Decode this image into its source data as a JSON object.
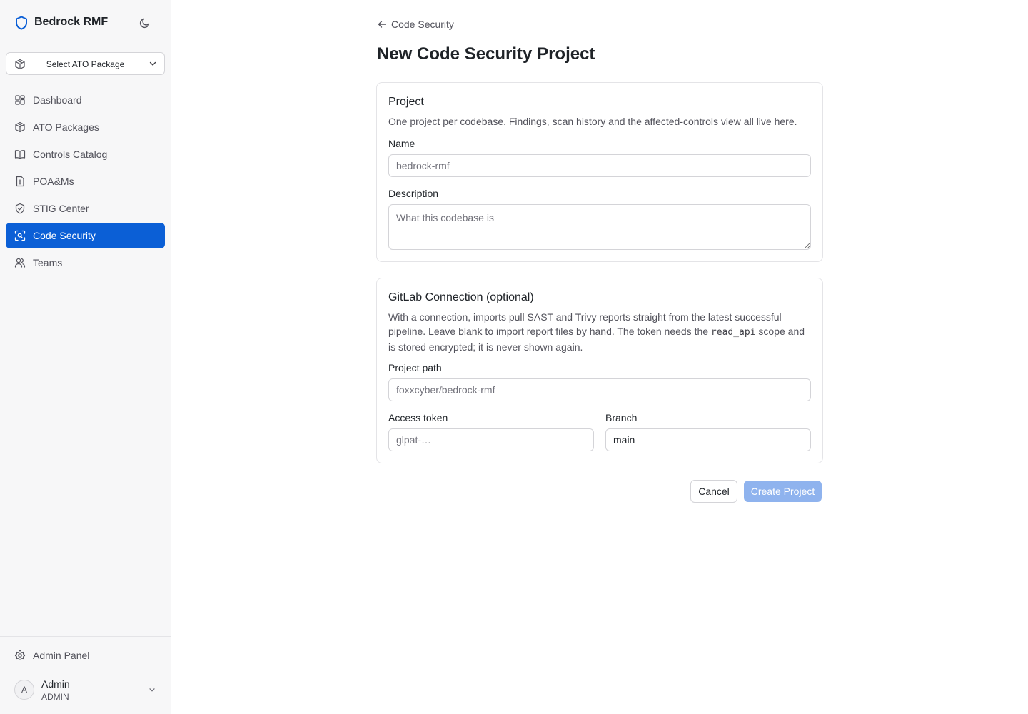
{
  "app": {
    "name": "Bedrock RMF"
  },
  "sidebar": {
    "package_select": {
      "label": "Select ATO Package",
      "icon": "package-icon"
    },
    "items": [
      {
        "label": "Dashboard",
        "icon": "dashboard-icon",
        "active": false
      },
      {
        "label": "ATO Packages",
        "icon": "package-icon",
        "active": false
      },
      {
        "label": "Controls Catalog",
        "icon": "book-icon",
        "active": false
      },
      {
        "label": "POA&Ms",
        "icon": "file-alert-icon",
        "active": false
      },
      {
        "label": "STIG Center",
        "icon": "shield-check-icon",
        "active": false
      },
      {
        "label": "Code Security",
        "icon": "scan-icon",
        "active": true
      },
      {
        "label": "Teams",
        "icon": "users-icon",
        "active": false
      }
    ],
    "admin_panel": {
      "label": "Admin Panel",
      "icon": "gear-icon"
    },
    "user": {
      "initial": "A",
      "name": "Admin",
      "role": "ADMIN"
    }
  },
  "page": {
    "back_label": "Code Security",
    "title": "New Code Security Project"
  },
  "project_card": {
    "title": "Project",
    "description": "One project per codebase. Findings, scan history and the affected-controls view all live here.",
    "name_label": "Name",
    "name_placeholder": "bedrock-rmf",
    "name_value": "",
    "description_label": "Description",
    "description_placeholder": "What this codebase is",
    "description_value": ""
  },
  "gitlab_card": {
    "title": "GitLab Connection (optional)",
    "description_before": "With a connection, imports pull SAST and Trivy reports straight from the latest successful pipeline. Leave blank to import report files by hand. The token needs the ",
    "description_code": "read_api",
    "description_after": " scope and is stored encrypted; it is never shown again.",
    "project_path_label": "Project path",
    "project_path_placeholder": "foxxcyber/bedrock-rmf",
    "access_token_label": "Access token",
    "access_token_placeholder": "glpat-…",
    "branch_label": "Branch",
    "branch_value": "main"
  },
  "actions": {
    "cancel_label": "Cancel",
    "create_label": "Create Project"
  },
  "colors": {
    "accent": "#0b5fd6",
    "accent_disabled": "#8fb3ee",
    "sidebar_bg": "#f7f7f8",
    "border": "#e4e4e7"
  }
}
